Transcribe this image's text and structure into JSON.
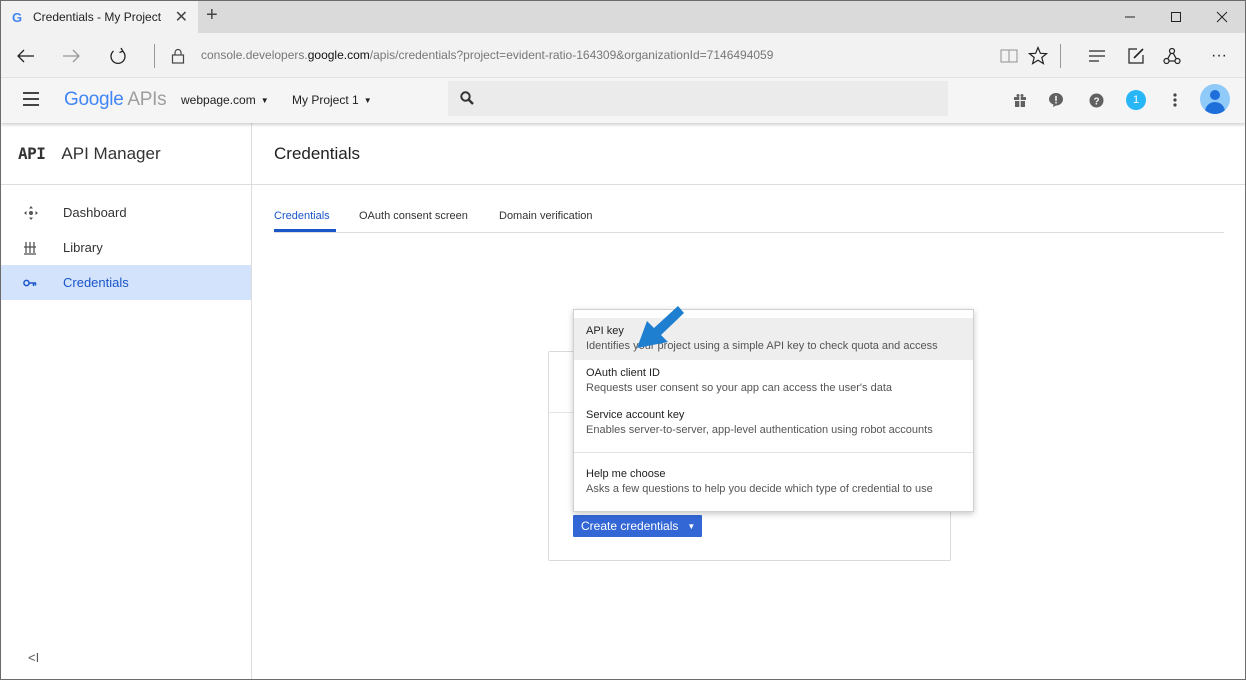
{
  "browser": {
    "tab_title": "Credentials - My Project",
    "tab_favicon": "G",
    "newtab_label": "+",
    "url_prefix": "console.developers.",
    "url_domain": "google.com",
    "url_suffix": "/apis/credentials?project=evident-ratio-164309&organizationId=7146494059"
  },
  "gbar": {
    "logo_google": "Google",
    "logo_apis": " APIs",
    "org_selector": "webpage.com",
    "project_selector": "My Project 1",
    "notification_count": "1"
  },
  "sidebar": {
    "logo": "API",
    "title": "API Manager",
    "items": [
      {
        "label": "Dashboard",
        "icon": "dashboard-icon"
      },
      {
        "label": "Library",
        "icon": "library-icon"
      },
      {
        "label": "Credentials",
        "icon": "key-icon",
        "active": true
      }
    ],
    "collapse_label": "<I"
  },
  "main": {
    "page_title": "Credentials",
    "tabs": [
      {
        "label": "Credentials",
        "active": true
      },
      {
        "label": "OAuth consent screen"
      },
      {
        "label": "Domain verification"
      }
    ],
    "create_button": "Create credentials"
  },
  "menu": {
    "items": [
      {
        "title": "API key",
        "desc": "Identifies your project using a simple API key to check quota and access",
        "highlighted": true
      },
      {
        "title": "OAuth client ID",
        "desc": "Requests user consent so your app can access the user's data"
      },
      {
        "title": "Service account key",
        "desc": "Enables server-to-server, app-level authentication using robot accounts"
      },
      {
        "title": "Help me choose",
        "desc": "Asks a few questions to help you decide which type of credential to use"
      }
    ]
  },
  "colors": {
    "accent": "#1a56c9",
    "button": "#3367d6",
    "active_nav_bg": "#d3e3fc",
    "arrow": "#1e7fd1"
  }
}
